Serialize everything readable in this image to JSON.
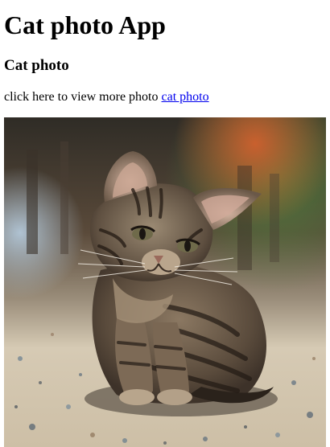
{
  "page": {
    "heading": "Cat photo App",
    "subheading": "Cat photo",
    "intro_text": "click here to view more photo",
    "link_text": "cat photo"
  },
  "image": {
    "subject": "tabby kitten sitting on terrazzo floor",
    "background_colors": [
      "#3b3a33",
      "#6b5a47",
      "#c8603a",
      "#3c6b3a"
    ],
    "floor_color": "#d9cbb4"
  }
}
